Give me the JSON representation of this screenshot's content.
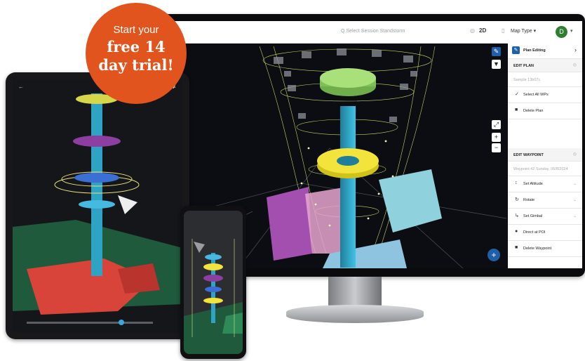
{
  "badge": {
    "line1": "Start your",
    "line2": "free 14",
    "line3": "day trial!"
  },
  "topbar": {
    "search_placeholder": "Q  Select Session Standstorm",
    "view_mode": "2D",
    "map_type": "Map Type",
    "avatar_initial": "D"
  },
  "side_panel": {
    "header": "Plan Editing",
    "edit_plan_title": "EDIT PLAN",
    "plan_name_placeholder": "Sample 13b07c",
    "select_all": "Select All WPs",
    "delete_plan": "Delete Plan",
    "edit_waypoint_title": "EDIT WAYPOINT",
    "waypoint_placeholder": "Waypoint 42 Sunday, 06/8/2024",
    "set_altitude": "Set Altitude",
    "rotate": "Rotate",
    "set_gimbal": "Set Gimbal",
    "direct_at_poi": "Direct at POI",
    "delete_waypoint": "Delete Waypoint"
  },
  "colors": {
    "badge": "#e2541d",
    "accent": "#1e5fa8",
    "avatar": "#2e7d32"
  }
}
